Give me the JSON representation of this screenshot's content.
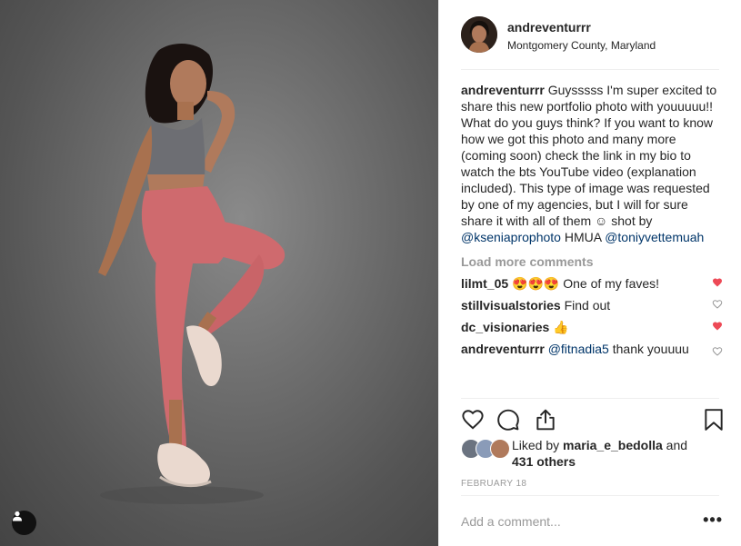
{
  "post": {
    "username": "andreventurrr",
    "location": "Montgomery County, Maryland",
    "caption_text": "Guysssss I'm super excited to share this new portfolio photo with youuuuu!! What do you guys think? If you want to know how we got this photo and many more (coming soon) check the link in my bio to watch the bts YouTube video (explanation included). This type of image was requested by one of my agencies, but I will for sure share it with all of them ☺ shot by",
    "mention1": "@kseniaprophoto",
    "between": "HMUA",
    "mention2": "@toniyvettemuah"
  },
  "load_more": "Load more comments",
  "comments": [
    {
      "user": "lilmt_05",
      "text": "😍😍😍 One of my faves!",
      "liked": true
    },
    {
      "user": "stillvisualstories",
      "text": "Find out",
      "liked": false
    },
    {
      "user": "dc_visionaries",
      "text": "👍",
      "liked": true
    },
    {
      "user": "andreventurrr",
      "mention": "@fitnadia5",
      "text": "thank youuuu",
      "liked": false
    }
  ],
  "likes": {
    "prefix": "Liked by",
    "user": "maria_e_bedolla",
    "and": "and",
    "others": "431 others"
  },
  "date": "FEBRUARY 18",
  "add_comment_placeholder": "Add a comment...",
  "more_label": "•••",
  "icons": {
    "like": "heart-icon",
    "comment": "comment-bubble-icon",
    "share": "share-icon",
    "save": "bookmark-icon",
    "user_tag": "person-icon"
  },
  "colors": {
    "liked_heart": "#ed4956",
    "mention": "#003569",
    "muted": "#999999"
  }
}
